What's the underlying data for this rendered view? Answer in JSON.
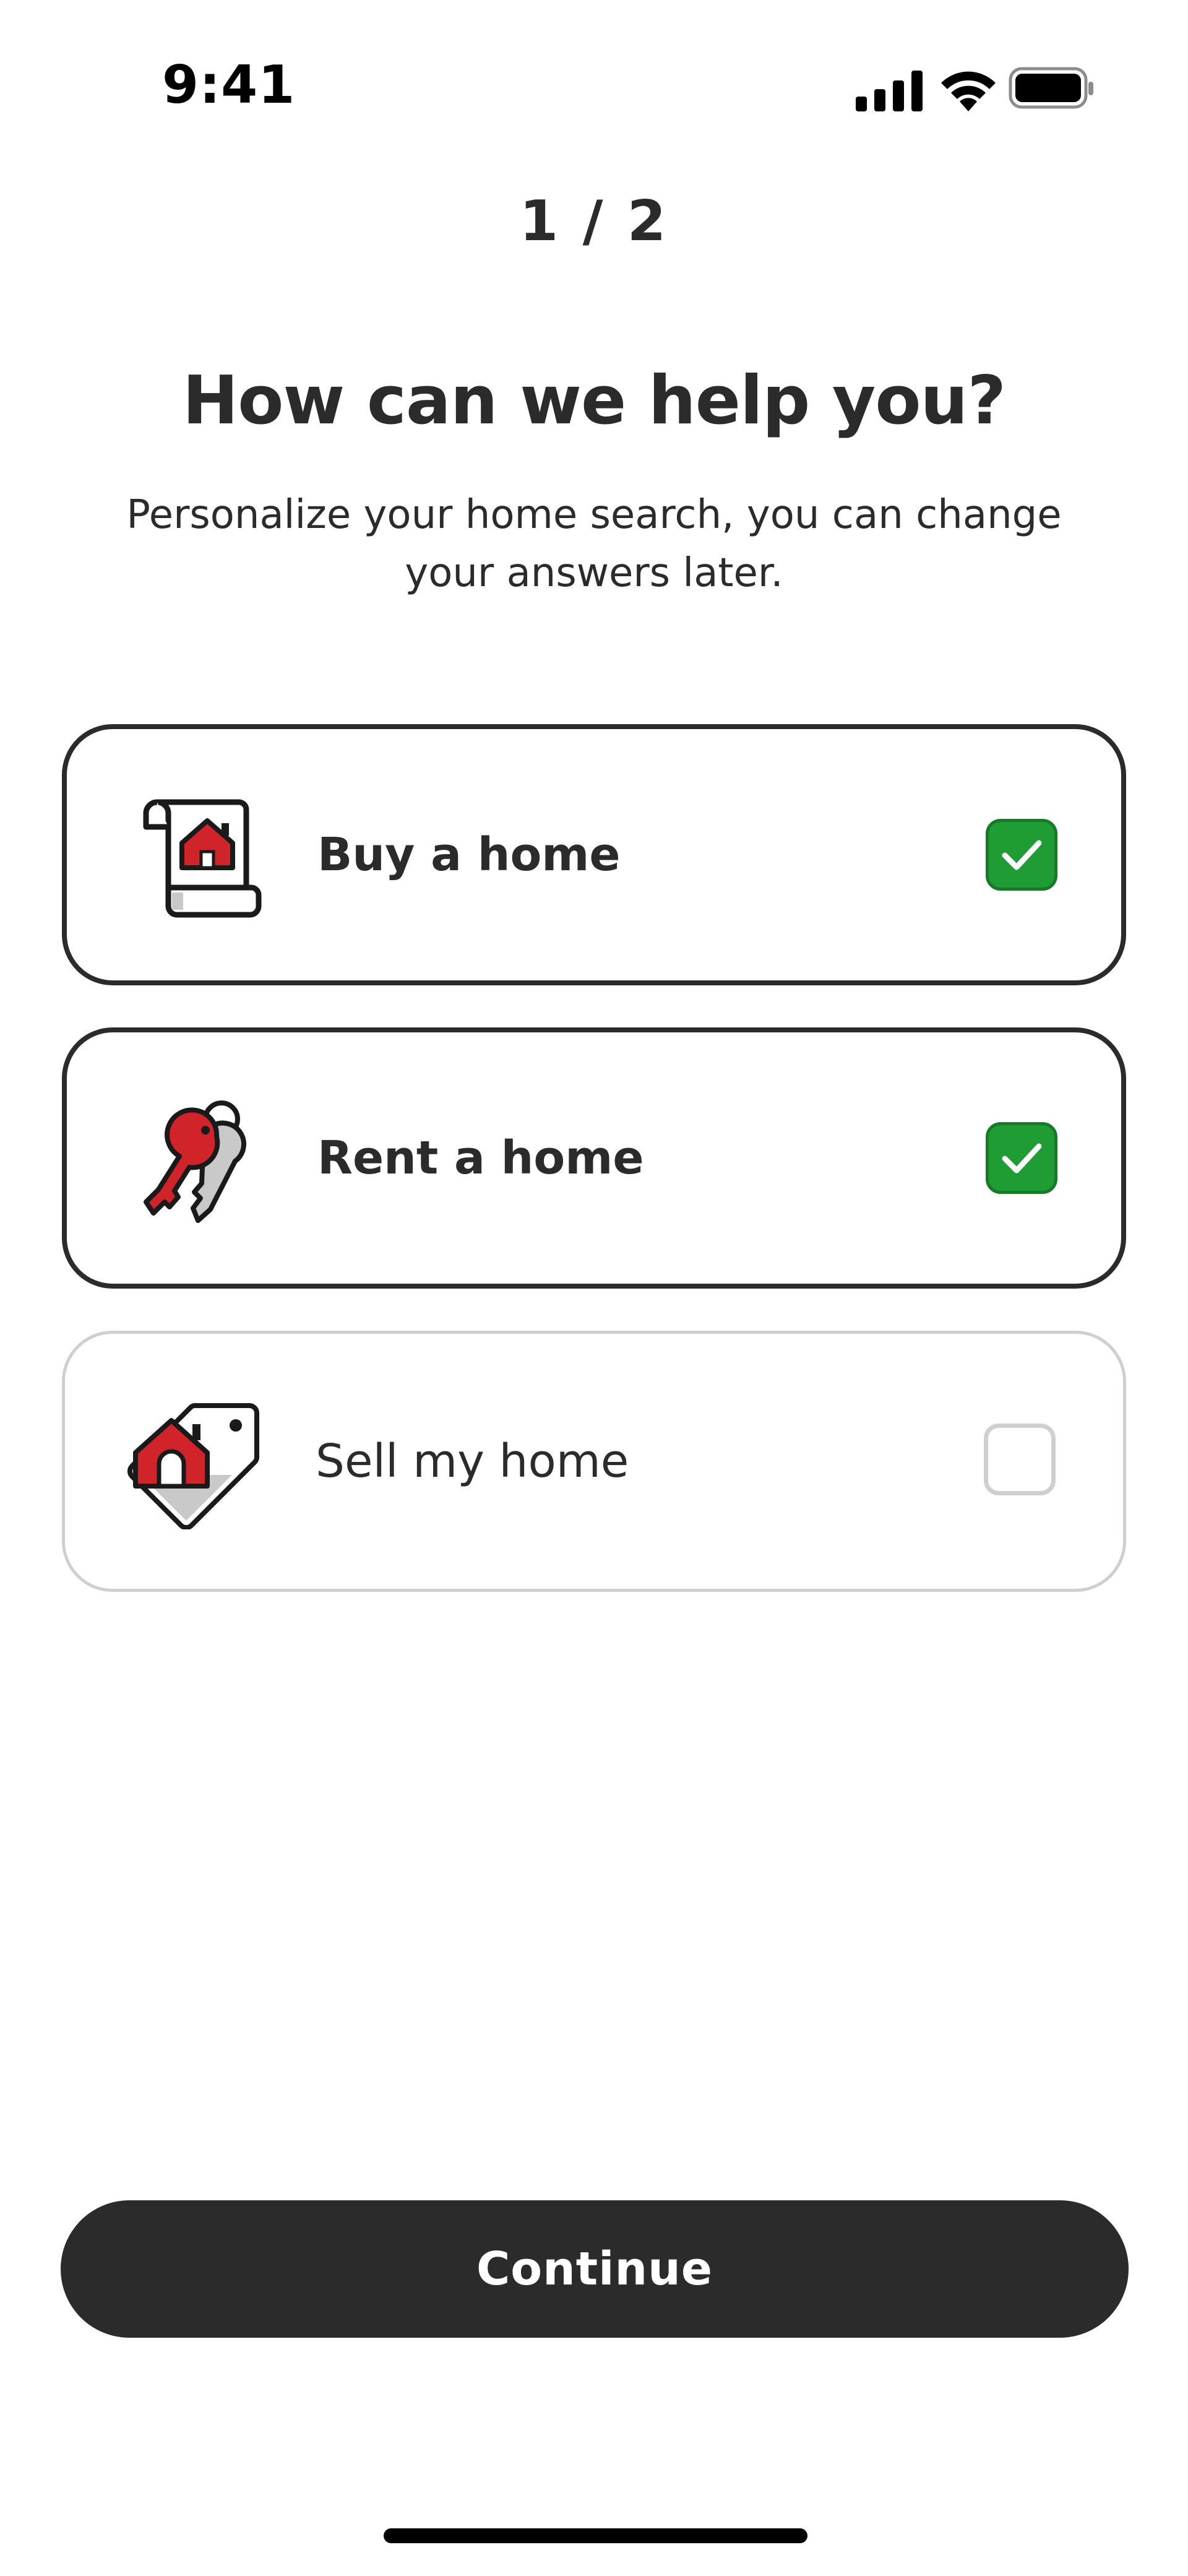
{
  "status_bar": {
    "time": "9:41",
    "icons": [
      "cellular-signal-icon",
      "wifi-icon",
      "battery-icon"
    ]
  },
  "header": {
    "step": "1 / 2",
    "title": "How can we help you?",
    "subtitle": "Personalize your home search, you can change your answers later."
  },
  "options": [
    {
      "label": "Buy a home",
      "icon": "buy-home-deed-icon",
      "checked": true
    },
    {
      "label": "Rent a home",
      "icon": "rent-keys-icon",
      "checked": true
    },
    {
      "label": "Sell my home",
      "icon": "sell-home-tag-icon",
      "checked": false
    }
  ],
  "footer": {
    "continue_label": "Continue"
  },
  "colors": {
    "text": "#2b2b2b",
    "accent_green": "#1f9c34",
    "brand_red": "#d1232a",
    "unselected_border": "#cfcfcf"
  }
}
